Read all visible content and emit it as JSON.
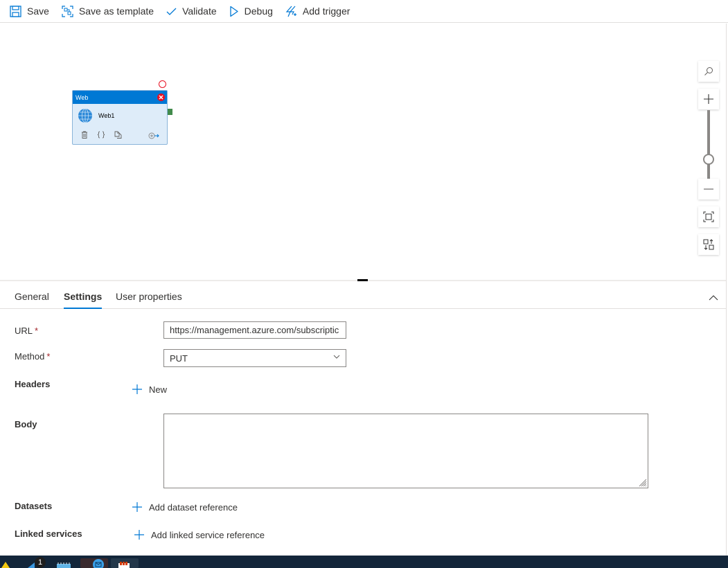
{
  "toolbar": {
    "save": "Save",
    "save_as_template": "Save as template",
    "validate": "Validate",
    "debug": "Debug",
    "add_trigger": "Add trigger"
  },
  "canvas": {
    "activity": {
      "type": "Web",
      "name": "Web1",
      "icon": "globe-icon",
      "actions": [
        "delete-icon",
        "code-icon",
        "copy-icon",
        "add-output-icon"
      ]
    },
    "zoom_controls": [
      "search-icon",
      "zoom-in-icon",
      "zoom-slider",
      "zoom-out-icon",
      "fit-to-screen-icon",
      "auto-align-icon"
    ],
    "zoom_level": 0.5
  },
  "tabs": [
    {
      "label": "General",
      "active": false
    },
    {
      "label": "Settings",
      "active": true
    },
    {
      "label": "User properties",
      "active": false
    }
  ],
  "form": {
    "url": {
      "label": "URL",
      "required": "*",
      "value": "https://management.azure.com/subscriptic"
    },
    "method": {
      "label": "Method",
      "required": "*",
      "value": "PUT"
    },
    "headers": {
      "label": "Headers",
      "action": "New"
    },
    "body": {
      "label": "Body",
      "value": ""
    },
    "datasets": {
      "label": "Datasets",
      "action": "Add dataset reference"
    },
    "linked_services": {
      "label": "Linked services",
      "action": "Add linked service reference"
    }
  },
  "colors": {
    "accent": "#0078d4",
    "error": "#e81123",
    "required": "#a4262c",
    "taskbar": "#13263a"
  },
  "taskbar": {
    "badge_count": "1"
  }
}
